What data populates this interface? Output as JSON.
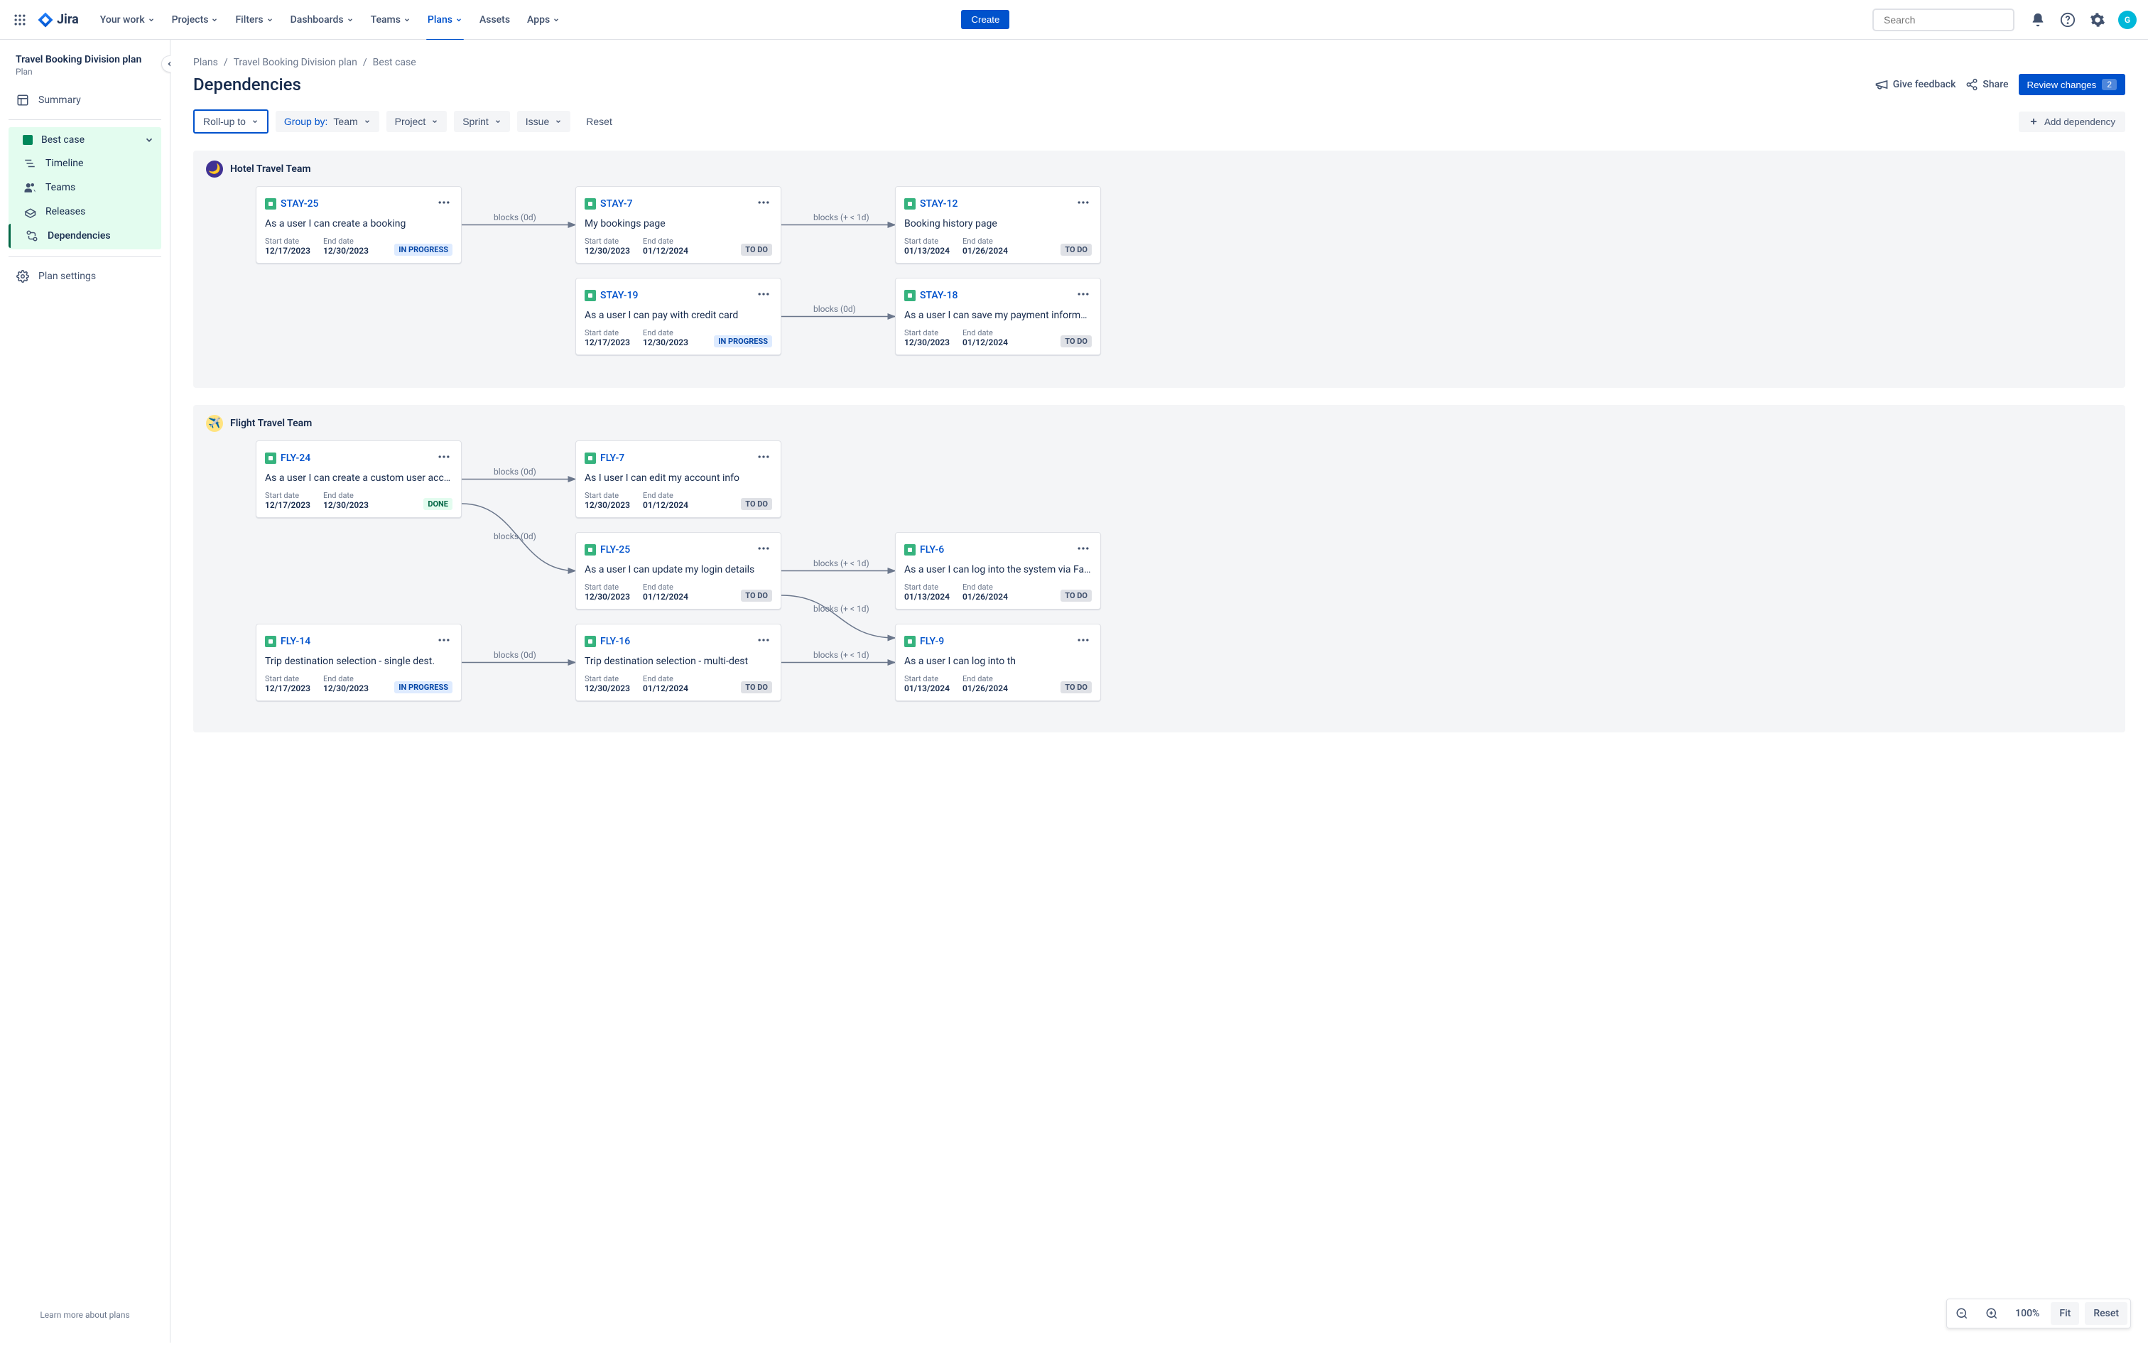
{
  "nav": {
    "logo": "Jira",
    "items": [
      "Your work",
      "Projects",
      "Filters",
      "Dashboards",
      "Teams",
      "Plans",
      "Assets",
      "Apps"
    ],
    "active_index": 5,
    "create": "Create",
    "search_placeholder": "Search"
  },
  "sidebar": {
    "title": "Travel Booking Division plan",
    "subtitle": "Plan",
    "summary": "Summary",
    "scenario": "Best case",
    "items": [
      "Timeline",
      "Teams",
      "Releases",
      "Dependencies"
    ],
    "selected_index": 3,
    "plan_settings": "Plan settings",
    "footer": "Learn more about plans"
  },
  "breadcrumbs": [
    "Plans",
    "Travel Booking Division plan",
    "Best case"
  ],
  "page": {
    "title": "Dependencies",
    "feedback": "Give feedback",
    "share": "Share",
    "review": "Review changes",
    "review_count": "2"
  },
  "filters": {
    "rollup": "Roll-up to",
    "groupby_label": "Group by:",
    "groupby_value": "Team",
    "project": "Project",
    "sprint": "Sprint",
    "issue": "Issue",
    "reset": "Reset",
    "add_dep": "Add dependency"
  },
  "labels": {
    "start_date": "Start date",
    "end_date": "End date",
    "blocks_0d": "blocks (0d)",
    "blocks_lt1d": "blocks (+ < 1d)"
  },
  "teams": [
    {
      "name": "Hotel Travel Team",
      "avatar_emoji": "🌙",
      "avatar_bg": "#403294",
      "rows": [
        [
          {
            "key": "STAY-25",
            "title": "As a user I can create a booking",
            "start": "12/17/2023",
            "end": "12/30/2023",
            "status": "IN PROGRESS",
            "status_class": "inprogress",
            "conn_label": "blocks (0d)"
          },
          {
            "key": "STAY-7",
            "title": "My bookings page",
            "start": "12/30/2023",
            "end": "01/12/2024",
            "status": "TO DO",
            "status_class": "",
            "conn_label": "blocks (+ < 1d)"
          },
          {
            "key": "STAY-12",
            "title": "Booking history page",
            "start": "01/13/2024",
            "end": "01/26/2024",
            "status": "TO DO",
            "status_class": ""
          }
        ],
        [
          null,
          {
            "key": "STAY-19",
            "title": "As a user I can pay with credit card",
            "start": "12/17/2023",
            "end": "12/30/2023",
            "status": "IN PROGRESS",
            "status_class": "inprogress",
            "conn_label": "blocks (0d)"
          },
          {
            "key": "STAY-18",
            "title": "As a user I can save my payment inform…",
            "start": "12/30/2023",
            "end": "01/12/2024",
            "status": "TO DO",
            "status_class": ""
          }
        ]
      ]
    },
    {
      "name": "Flight Travel Team",
      "avatar_emoji": "✈️",
      "avatar_bg": "#FFE380",
      "rows": [
        [
          {
            "key": "FLY-24",
            "title": "As a user I can create a custom user acc…",
            "start": "12/17/2023",
            "end": "12/30/2023",
            "status": "DONE",
            "status_class": "done",
            "conn_label": "blocks (0d)"
          },
          {
            "key": "FLY-7",
            "title": "As I user I can edit my account info",
            "start": "12/30/2023",
            "end": "01/12/2024",
            "status": "TO DO",
            "status_class": ""
          },
          null
        ],
        [
          null,
          {
            "key": "FLY-25",
            "title": "As a user I can update my login details",
            "start": "12/30/2023",
            "end": "01/12/2024",
            "status": "TO DO",
            "status_class": "",
            "conn_label": "blocks (+ < 1d)",
            "pre_label": "blocks (0d)"
          },
          {
            "key": "FLY-6",
            "title": "As a user I can log into the system via Fa…",
            "start": "01/13/2024",
            "end": "01/26/2024",
            "status": "TO DO",
            "status_class": ""
          }
        ],
        [
          {
            "key": "FLY-14",
            "title": "Trip destination selection - single dest.",
            "start": "12/17/2023",
            "end": "12/30/2023",
            "status": "IN PROGRESS",
            "status_class": "inprogress",
            "conn_label": "blocks (0d)"
          },
          {
            "key": "FLY-16",
            "title": "Trip destination selection - multi-dest",
            "start": "12/30/2023",
            "end": "01/12/2024",
            "status": "TO DO",
            "status_class": "",
            "conn_label": "blocks (+ < 1d)"
          },
          {
            "key": "FLY-9",
            "title": "As a user I can log into th",
            "start": "01/13/2024",
            "end": "01/26/2024",
            "status": "TO DO",
            "status_class": ""
          }
        ]
      ]
    }
  ],
  "zoom": {
    "value": "100%",
    "fit": "Fit",
    "reset": "Reset"
  }
}
